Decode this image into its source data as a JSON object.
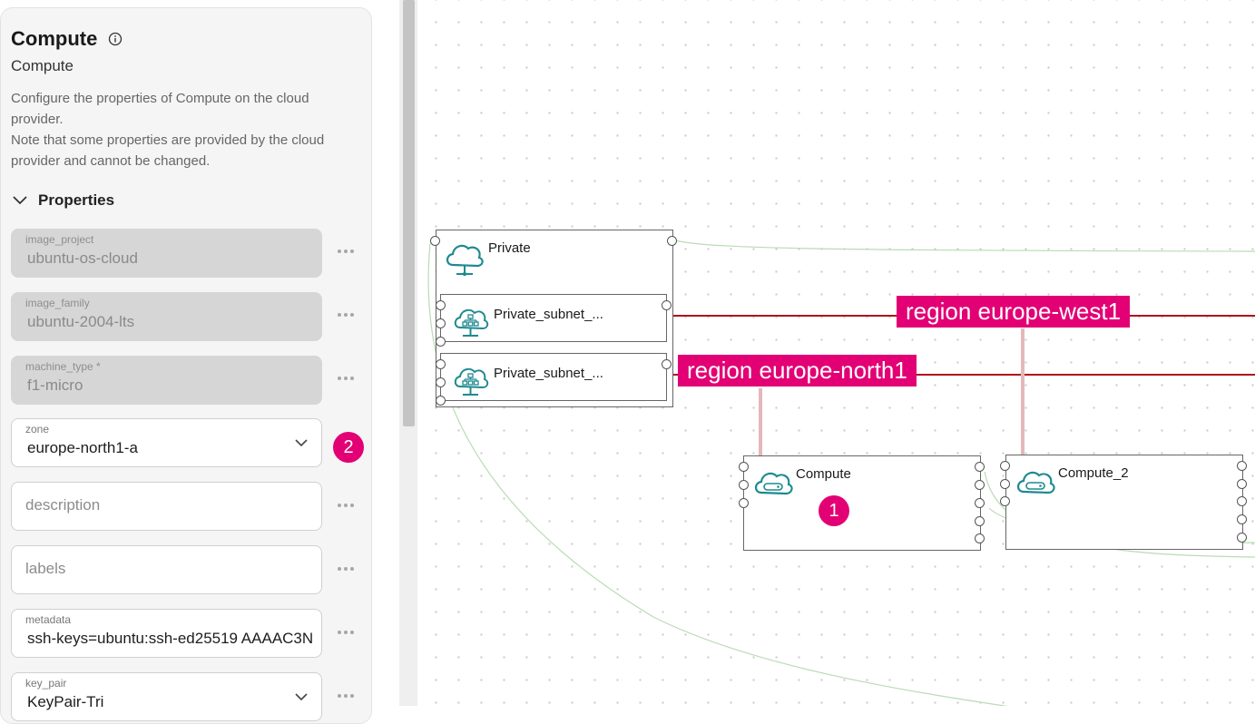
{
  "panel": {
    "title": "Compute",
    "subtitle": "Compute",
    "description_lines": [
      "Configure the properties of Compute on the cloud",
      "provider.",
      "Note that some properties are provided by the cloud",
      "provider and cannot be changed."
    ],
    "section_label": "Properties",
    "fields": {
      "image_project": {
        "label": "image_project",
        "value": "ubuntu-os-cloud"
      },
      "image_family": {
        "label": "image_family",
        "value": "ubuntu-2004-lts"
      },
      "machine_type": {
        "label": "machine_type *",
        "value": "f1-micro"
      },
      "zone": {
        "label": "zone",
        "value": "europe-north1-a"
      },
      "description": {
        "placeholder": "description"
      },
      "labels": {
        "placeholder": "labels"
      },
      "metadata": {
        "label": "metadata",
        "value": "ssh-keys=ubuntu:ssh-ed25519 AAAAC3N"
      },
      "key_pair": {
        "label": "key_pair",
        "value": "KeyPair-Tri"
      }
    },
    "zone_badge": "2"
  },
  "canvas": {
    "private_node": {
      "title": "Private",
      "icon": "cloud-network-icon"
    },
    "subnet_nodes": [
      {
        "title": "Private_subnet_...",
        "icon": "cloud-subnet-icon"
      },
      {
        "title": "Private_subnet_...",
        "icon": "cloud-subnet-icon"
      }
    ],
    "compute_nodes": [
      {
        "title": "Compute",
        "icon": "cloud-compute-icon",
        "badge": "1"
      },
      {
        "title": "Compute_2",
        "icon": "cloud-compute-icon"
      }
    ],
    "region_labels": [
      "region europe-west1",
      "region europe-north1"
    ]
  },
  "colors": {
    "accent": "#e20074",
    "region_line": "#b0121c",
    "icon_teal": "#1e8a8f",
    "wire_green": "#b9dcb4"
  }
}
